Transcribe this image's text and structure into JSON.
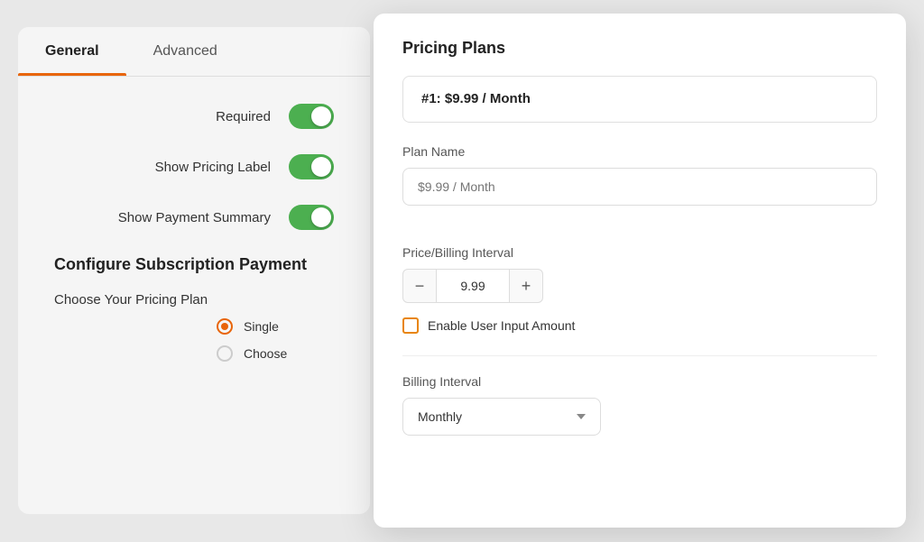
{
  "tabs": [
    {
      "id": "general",
      "label": "General",
      "active": true
    },
    {
      "id": "advanced",
      "label": "Advanced",
      "active": false
    }
  ],
  "settings": {
    "required": {
      "label": "Required",
      "enabled": true
    },
    "show_pricing_label": {
      "label": "Show Pricing Label",
      "enabled": true
    },
    "show_payment_summary": {
      "label": "Show Payment Summary",
      "enabled": true
    }
  },
  "configure_section": {
    "title": "Configure Subscription Payment",
    "pricing_plan_label": "Choose Your Pricing Plan",
    "options": [
      {
        "id": "single",
        "label": "Single",
        "selected": true
      },
      {
        "id": "choose",
        "label": "Choose",
        "selected": false
      }
    ]
  },
  "modal": {
    "title": "Pricing Plans",
    "plan": {
      "header": "#1: $9.99 / Month",
      "plan_name_label": "Plan Name",
      "plan_name_placeholder": "$9.99 / Month",
      "price_billing_label": "Price/Billing Interval",
      "price_value": "9.99",
      "minus_label": "−",
      "plus_label": "+",
      "enable_user_input_label": "Enable User Input Amount",
      "billing_interval_label": "Billing Interval",
      "billing_interval_value": "Monthly"
    }
  },
  "colors": {
    "accent": "#e8650a",
    "toggle_on": "#4caf50"
  }
}
